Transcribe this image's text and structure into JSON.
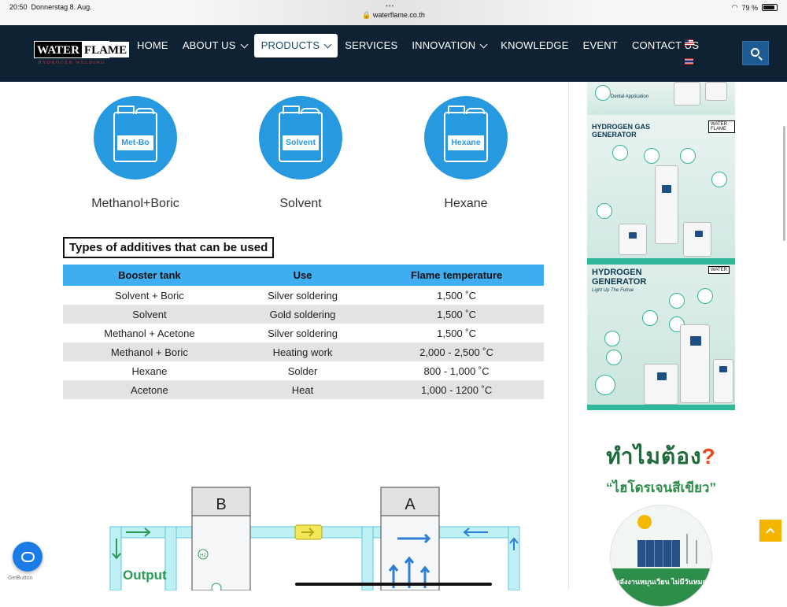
{
  "status": {
    "time": "20:50",
    "date": "Donnerstag 8. Aug.",
    "url": "waterflame.co.th",
    "battery": "79 %"
  },
  "logo": {
    "part1": "WATER",
    "part2": "FLAME",
    "tagline": "HYDROGEN WELDING"
  },
  "nav": {
    "items": [
      {
        "label": "HOME"
      },
      {
        "label": "ABOUT US"
      },
      {
        "label": "PRODUCTS"
      },
      {
        "label": "SERVICES"
      },
      {
        "label": "INNOVATION"
      },
      {
        "label": "KNOWLEDGE"
      },
      {
        "label": "EVENT"
      },
      {
        "label": "CONTACT US"
      }
    ]
  },
  "additives": [
    {
      "badge": "Met-Bo",
      "name": "Methanol+Boric"
    },
    {
      "badge": "Solvent",
      "name": "Solvent"
    },
    {
      "badge": "Hexane",
      "name": "Hexane"
    }
  ],
  "table": {
    "title": "Types of additives that can be used",
    "headers": [
      "Booster tank",
      "Use",
      "Flame temperature"
    ],
    "rows": [
      [
        "Solvent + Boric",
        "Silver soldering",
        "1,500 ˚C"
      ],
      [
        "Solvent",
        "Gold soldering",
        "1,500 ˚C"
      ],
      [
        "Methanol + Acetone",
        "Silver soldering",
        "1,500 ˚C"
      ],
      [
        "Methanol + Boric",
        "Heating work",
        "2,000 - 2,500 ˚C"
      ],
      [
        "Hexane",
        "Solder",
        "800 - 1,000 ˚C"
      ],
      [
        "Acetone",
        "Heat",
        "1,000 - 1200 ˚C"
      ]
    ]
  },
  "diagram": {
    "tank_b": "B",
    "tank_a": "A",
    "output": "Output",
    "h2": "H2"
  },
  "sidebar": {
    "banner1_app": "Dental Application",
    "banner2_title": "HYDROGEN GAS GENERATOR",
    "banner3_title": "HYDROGEN GENERATOR",
    "banner3_sub": "Light Up The Futrue",
    "promo_question": "ทำไมต้อง",
    "promo_mark": "?",
    "promo_green": "“ไฮโดรเจนสีเขียว”",
    "promo_band": "พลังงานหมุนเวียน ไม่มีวันหมด"
  },
  "getbutton": {
    "label": "GetButton"
  },
  "colors": {
    "nav_bg": "#0e2233",
    "accent_blue": "#2699e0",
    "table_header": "#3eaef0",
    "scroll_top": "#f4b400"
  }
}
